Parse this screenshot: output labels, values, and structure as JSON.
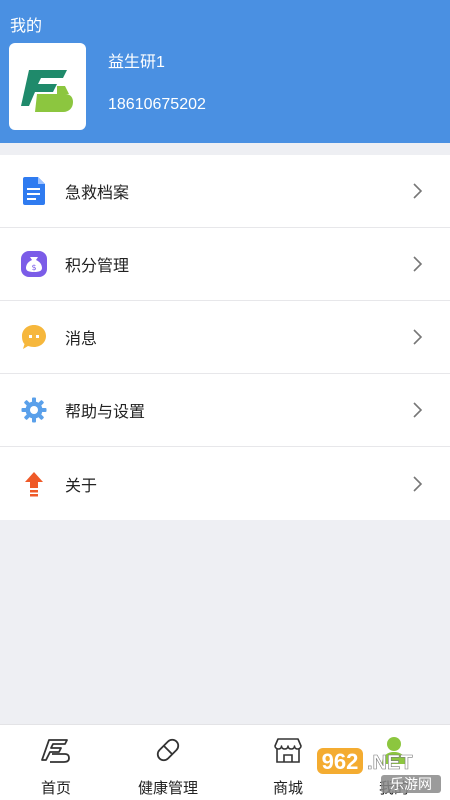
{
  "header": {
    "title": "我的",
    "username": "益生研1",
    "phone": "18610675202"
  },
  "menu": {
    "items": [
      {
        "label": "急救档案",
        "icon": "document-icon"
      },
      {
        "label": "积分管理",
        "icon": "money-bag-icon"
      },
      {
        "label": "消息",
        "icon": "chat-bubble-icon"
      },
      {
        "label": "帮助与设置",
        "icon": "gear-icon"
      },
      {
        "label": "关于",
        "icon": "upload-arrow-icon"
      }
    ]
  },
  "tabs": [
    {
      "label": "首页",
      "icon": "home-logo-icon"
    },
    {
      "label": "健康管理",
      "icon": "capsule-icon"
    },
    {
      "label": "商城",
      "icon": "shop-icon"
    },
    {
      "label": "我的",
      "icon": "user-icon"
    }
  ],
  "watermark": {
    "brand_number": "962",
    "brand_suffix": ".NET",
    "brand_text": "乐游网"
  },
  "colors": {
    "header_bg": "#4a90e2",
    "page_bg": "#eeeff3"
  }
}
